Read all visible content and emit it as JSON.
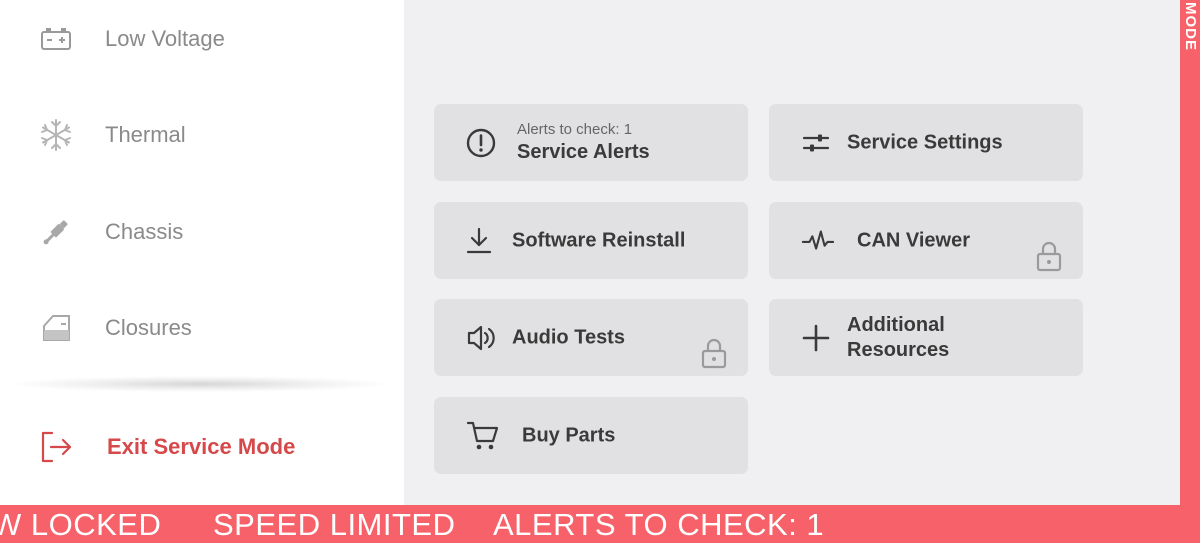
{
  "sidebar": {
    "items": [
      {
        "label": "Low Voltage",
        "icon": "battery-icon"
      },
      {
        "label": "Thermal",
        "icon": "snowflake-icon"
      },
      {
        "label": "Chassis",
        "icon": "shock-absorber-icon"
      },
      {
        "label": "Closures",
        "icon": "car-door-icon"
      }
    ],
    "exit": {
      "label": "Exit Service Mode",
      "icon": "exit-icon"
    }
  },
  "tiles": {
    "service_alerts": {
      "subtitle": "Alerts to check: 1",
      "label": "Service Alerts",
      "icon": "alert-circle-icon"
    },
    "service_settings": {
      "label": "Service Settings",
      "icon": "sliders-icon"
    },
    "software_reinstall": {
      "label": "Software Reinstall",
      "icon": "download-icon"
    },
    "can_viewer": {
      "label": "CAN Viewer",
      "icon": "waveform-icon",
      "locked": true
    },
    "audio_tests": {
      "label": "Audio Tests",
      "icon": "speaker-icon",
      "locked": true
    },
    "additional_resources": {
      "label_line1": "Additional",
      "label_line2": "Resources",
      "icon": "plus-icon"
    },
    "buy_parts": {
      "label": "Buy Parts",
      "icon": "cart-icon"
    }
  },
  "right_stripe": {
    "text": "MODE"
  },
  "banner": {
    "items": [
      "W LOCKED",
      "SPEED LIMITED",
      "ALERTS TO CHECK: 1"
    ]
  },
  "colors": {
    "accent": "#f7626a",
    "exit_red": "#d6494b",
    "tile_bg": "#e1e1e3",
    "main_bg": "#f0f0f2"
  }
}
